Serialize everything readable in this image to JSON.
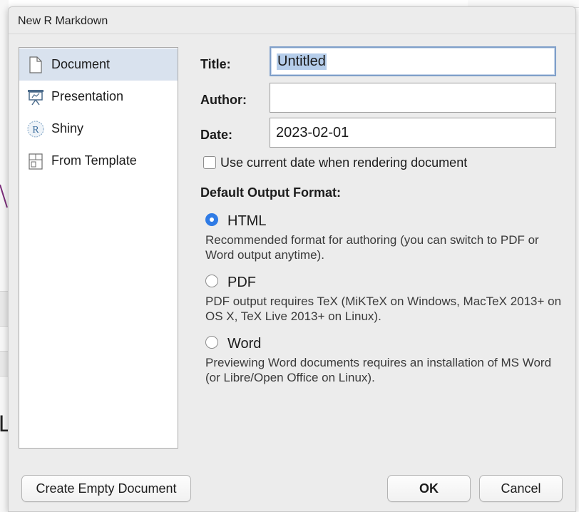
{
  "dialog": {
    "title": "New R Markdown"
  },
  "sidebar": {
    "items": [
      {
        "label": "Document",
        "icon": "document-icon",
        "selected": true
      },
      {
        "label": "Presentation",
        "icon": "presentation-icon",
        "selected": false
      },
      {
        "label": "Shiny",
        "icon": "shiny-r-icon",
        "selected": false
      },
      {
        "label": "From Template",
        "icon": "template-icon",
        "selected": false
      }
    ]
  },
  "form": {
    "title_label": "Title:",
    "title_value": "Untitled",
    "author_label": "Author:",
    "author_value": "",
    "date_label": "Date:",
    "date_value": "2023-02-01",
    "use_current_date_label": "Use current date when rendering document",
    "use_current_date_checked": false
  },
  "output_format": {
    "heading": "Default Output Format:",
    "options": [
      {
        "label": "HTML",
        "selected": true,
        "description": "Recommended format for authoring (you can switch to PDF or Word output anytime)."
      },
      {
        "label": "PDF",
        "selected": false,
        "description": "PDF output requires TeX (MiKTeX on Windows, MacTeX 2013+ on OS X, TeX Live 2013+ on Linux)."
      },
      {
        "label": "Word",
        "selected": false,
        "description": "Previewing Word documents requires an installation of MS Word (or Libre/Open Office on Linux)."
      }
    ]
  },
  "buttons": {
    "create_empty": "Create Empty Document",
    "ok": "OK",
    "cancel": "Cancel"
  },
  "colors": {
    "accent": "#2f7be5",
    "selection": "#d9e2ee",
    "focus_ring": "#7f9fc9"
  }
}
